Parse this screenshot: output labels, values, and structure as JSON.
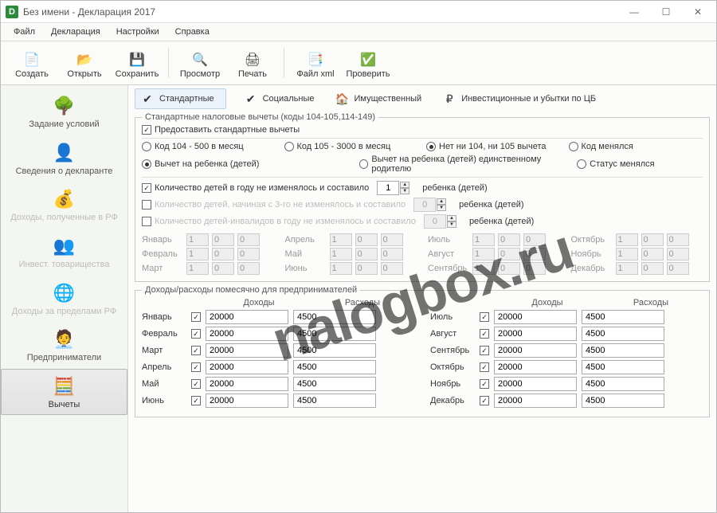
{
  "window": {
    "title": "Без имени - Декларация 2017"
  },
  "menu": [
    "Файл",
    "Декларация",
    "Настройки",
    "Справка"
  ],
  "toolbar": [
    {
      "label": "Создать",
      "icon": "📄"
    },
    {
      "label": "Открыть",
      "icon": "📂"
    },
    {
      "label": "Сохранить",
      "icon": "💾"
    },
    {
      "label": "Просмотр",
      "icon": "🔍"
    },
    {
      "label": "Печать",
      "icon": "🖨"
    },
    {
      "label": "Файл xml",
      "icon": "📑"
    },
    {
      "label": "Проверить",
      "icon": "✅"
    }
  ],
  "sidebar": [
    {
      "label": "Задание условий"
    },
    {
      "label": "Сведения о декларанте"
    },
    {
      "label": "Доходы, полученные в РФ",
      "disabled": true
    },
    {
      "label": "Инвест. товарищества",
      "disabled": true
    },
    {
      "label": "Доходы за пределами РФ",
      "disabled": true
    },
    {
      "label": "Предприниматели"
    },
    {
      "label": "Вычеты",
      "selected": true
    }
  ],
  "tabs": [
    {
      "label": "Стандартные",
      "active": true
    },
    {
      "label": "Социальные"
    },
    {
      "label": "Имущественный"
    },
    {
      "label": "Инвестиционные и убытки по ЦБ"
    }
  ],
  "std": {
    "legend": "Стандартные налоговые вычеты (коды 104-105,114-149)",
    "provide": "Предоставить стандартные вычеты",
    "opts1": [
      "Код 104 - 500 в месяц",
      "Код 105 - 3000 в месяц",
      "Нет ни 104, ни 105 вычета",
      "Код менялся"
    ],
    "opts1_sel": 2,
    "opts2": [
      "Вычет на ребенка (детей)",
      "Вычет на ребенка (детей) единственному родителю",
      "Статус менялся"
    ],
    "opts2_sel": 0,
    "childrows": [
      {
        "label": "Количество детей в году не изменялось и составило",
        "checked": true,
        "val": "1",
        "suffix": "ребенка (детей)"
      },
      {
        "label": "Количество детей, начиная с 3-го не изменялось и составило",
        "checked": false,
        "val": "0",
        "suffix": "ребенка (детей)"
      },
      {
        "label": "Количество детей-инвалидов в году не изменялось и составило",
        "checked": false,
        "val": "0",
        "suffix": "ребенка (детей)"
      }
    ],
    "months": [
      "Январь",
      "Февраль",
      "Март",
      "Апрель",
      "Май",
      "Июнь",
      "Июль",
      "Август",
      "Сентябрь",
      "Октябрь",
      "Ноябрь",
      "Декабрь"
    ],
    "mvals": [
      "1",
      "0",
      "0"
    ]
  },
  "ie": {
    "legend": "Доходы/расходы помесячно для предпринимателей",
    "headers": [
      "Доходы",
      "Расходы"
    ],
    "income": "20000",
    "expense": "4500"
  },
  "watermark": "nalogbox.ru"
}
